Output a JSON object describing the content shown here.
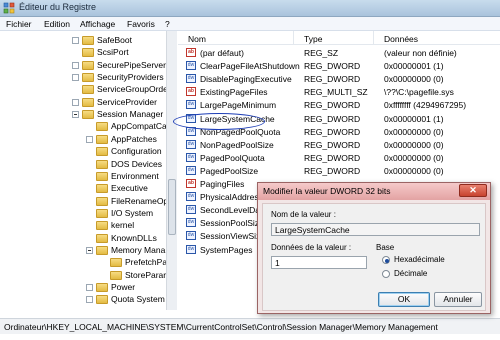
{
  "window": {
    "title": "Éditeur du Registre"
  },
  "menu": [
    "Fichier",
    "Edition",
    "Affichage",
    "Favoris",
    "?"
  ],
  "tree": [
    {
      "label": "SafeBoot",
      "expander": "closed"
    },
    {
      "label": "ScsiPort",
      "expander": "none"
    },
    {
      "label": "SecurePipeServers",
      "expander": "closed"
    },
    {
      "label": "SecurityProviders",
      "expander": "closed"
    },
    {
      "label": "ServiceGroupOrde",
      "expander": "none"
    },
    {
      "label": "ServiceProvider",
      "expander": "closed"
    },
    {
      "label": "Session Manager",
      "expander": "open"
    },
    {
      "label": "AppCompatCa",
      "expander": "none"
    },
    {
      "label": "AppPatches",
      "expander": "closed"
    },
    {
      "label": "Configuration",
      "expander": "none"
    },
    {
      "label": "DOS Devices",
      "expander": "none"
    },
    {
      "label": "Environment",
      "expander": "none"
    },
    {
      "label": "Executive",
      "expander": "none"
    },
    {
      "label": "FileRenameOp",
      "expander": "none"
    },
    {
      "label": "I/O System",
      "expander": "none"
    },
    {
      "label": "kernel",
      "expander": "none"
    },
    {
      "label": "KnownDLLs",
      "expander": "none"
    },
    {
      "label": "Memory Mana",
      "expander": "open"
    },
    {
      "label": "PrefetchPa",
      "expander": "none"
    },
    {
      "label": "StoreParar",
      "expander": "none"
    },
    {
      "label": "Power",
      "expander": "closed"
    },
    {
      "label": "Quota System",
      "expander": "closed"
    }
  ],
  "values_table": {
    "headers": [
      "Nom",
      "Type",
      "Données"
    ],
    "rows": [
      {
        "icon": "ab",
        "name": "(par défaut)",
        "type": "REG_SZ",
        "data": "(valeur non définie)"
      },
      {
        "icon": "dw",
        "name": "ClearPageFileAtShutdown",
        "type": "REG_DWORD",
        "data": "0x00000001 (1)"
      },
      {
        "icon": "dw",
        "name": "DisablePagingExecutive",
        "type": "REG_DWORD",
        "data": "0x00000000 (0)"
      },
      {
        "icon": "ab",
        "name": "ExistingPageFiles",
        "type": "REG_MULTI_SZ",
        "data": "\\??\\C:\\pagefile.sys"
      },
      {
        "icon": "dw",
        "name": "LargePageMinimum",
        "type": "REG_DWORD",
        "data": "0xffffffff (4294967295)"
      },
      {
        "icon": "dw",
        "name": "LargeSystemCache",
        "type": "REG_DWORD",
        "data": "0x00000001 (1)"
      },
      {
        "icon": "dw",
        "name": "NonPagedPoolQuota",
        "type": "REG_DWORD",
        "data": "0x00000000 (0)"
      },
      {
        "icon": "dw",
        "name": "NonPagedPoolSize",
        "type": "REG_DWORD",
        "data": "0x00000000 (0)"
      },
      {
        "icon": "dw",
        "name": "PagedPoolQuota",
        "type": "REG_DWORD",
        "data": "0x00000000 (0)"
      },
      {
        "icon": "dw",
        "name": "PagedPoolSize",
        "type": "REG_DWORD",
        "data": "0x00000000 (0)"
      },
      {
        "icon": "ab",
        "name": "PagingFiles",
        "type": "",
        "data": ""
      },
      {
        "icon": "dw",
        "name": "PhysicalAddress",
        "type": "",
        "data": ""
      },
      {
        "icon": "dw",
        "name": "SecondLevelDat",
        "type": "",
        "data": ""
      },
      {
        "icon": "dw",
        "name": "SessionPoolSize",
        "type": "",
        "data": ""
      },
      {
        "icon": "dw",
        "name": "SessionViewSize",
        "type": "",
        "data": ""
      },
      {
        "icon": "dw",
        "name": "SystemPages",
        "type": "",
        "data": ""
      }
    ]
  },
  "status_bar": "Ordinateur\\HKEY_LOCAL_MACHINE\\SYSTEM\\CurrentControlSet\\Control\\Session Manager\\Memory Management",
  "dialog": {
    "title": "Modifier la valeur DWORD 32 bits",
    "close_label": "✕",
    "name_label": "Nom de la valeur :",
    "name_value": "LargeSystemCache",
    "data_label": "Données de la valeur :",
    "data_value": "1",
    "base_label": "Base",
    "radio_hex": "Hexadécimale",
    "radio_dec": "Décimale",
    "selected_base": "Hexadécimale",
    "ok_label": "OK",
    "cancel_label": "Annuler"
  }
}
